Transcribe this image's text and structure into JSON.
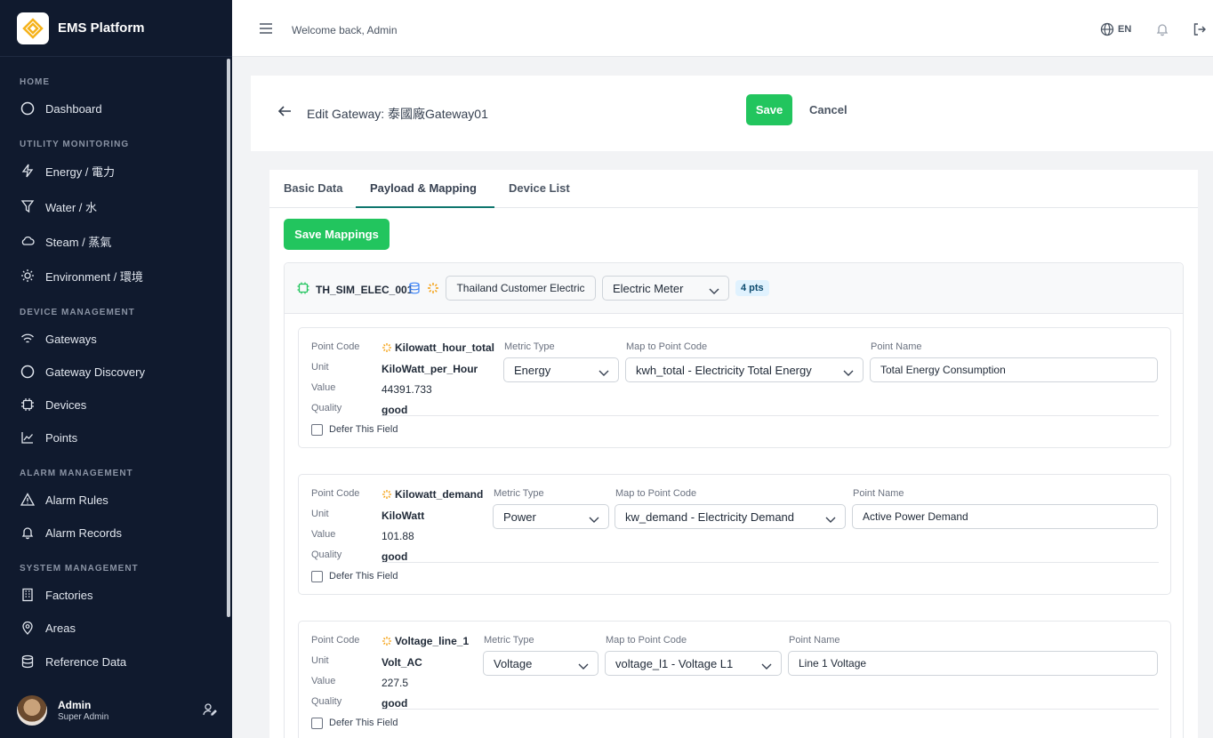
{
  "sidebar": {
    "brand": "EMS Platform",
    "sections": [
      "HOME",
      "UTILITY MONITORING",
      "DEVICE MANAGEMENT",
      "ALARM MANAGEMENT",
      "SYSTEM MANAGEMENT"
    ],
    "items": [
      {
        "label": "Dashboard",
        "icon": "circle-icon"
      },
      {
        "label": "Energy / 電力",
        "icon": "bolt-icon"
      },
      {
        "label": "Water / 水",
        "icon": "filter-icon"
      },
      {
        "label": "Steam / 蒸氣",
        "icon": "cloud-icon"
      },
      {
        "label": "Environment / 環境",
        "icon": "sun-icon"
      },
      {
        "label": "Gateways",
        "icon": "wifi-icon"
      },
      {
        "label": "Gateway Discovery",
        "icon": "circle-icon"
      },
      {
        "label": "Devices",
        "icon": "chip-icon"
      },
      {
        "label": "Points",
        "icon": "chart-icon"
      },
      {
        "label": "Alarm Rules",
        "icon": "warning-icon"
      },
      {
        "label": "Alarm Records",
        "icon": "bell-icon"
      },
      {
        "label": "Factories",
        "icon": "building-icon"
      },
      {
        "label": "Areas",
        "icon": "map-pin-icon"
      },
      {
        "label": "Reference Data",
        "icon": "database-icon"
      }
    ],
    "user": {
      "name": "Admin",
      "role": "Super Admin"
    }
  },
  "topbar": {
    "welcome": "Welcome back, Admin",
    "lang": "EN"
  },
  "edit": {
    "title": "Edit Gateway: 泰國廠Gateway01",
    "save": "Save",
    "cancel": "Cancel"
  },
  "tabs": [
    "Basic Data",
    "Payload & Mapping",
    "Device List"
  ],
  "active_tab": "Payload & Mapping",
  "save_mappings": "Save Mappings",
  "device": {
    "code": "TH_SIM_ELEC_001",
    "customer": "Thailand Customer Electric",
    "type": "Electric Meter",
    "points": "4 pts"
  },
  "labels": {
    "point_code": "Point Code",
    "unit": "Unit",
    "value": "Value",
    "quality": "Quality",
    "metric_type": "Metric Type",
    "map_to": "Map to Point Code",
    "point_name": "Point Name",
    "defer": "Defer This Field"
  },
  "mappings": [
    {
      "code": "Kilowatt_hour_total",
      "unit": "KiloWatt_per_Hour",
      "value": "44391.733",
      "quality": "good",
      "metric": "Energy",
      "map": "kwh_total - Electricity Total Energy",
      "name": "Total Energy Consumption"
    },
    {
      "code": "Kilowatt_demand",
      "unit": "KiloWatt",
      "value": "101.88",
      "quality": "good",
      "metric": "Power",
      "map": "kw_demand - Electricity Demand",
      "name": "Active Power Demand"
    },
    {
      "code": "Voltage_line_1",
      "unit": "Volt_AC",
      "value": "227.5",
      "quality": "good",
      "metric": "Voltage",
      "map": "voltage_l1 - Voltage L1",
      "name": "Line 1 Voltage"
    }
  ],
  "colors": {
    "sidebar": "#101a2e",
    "accent": "#22c55e",
    "tab_underline": "#0f766e",
    "spark": "#f59e0b"
  }
}
